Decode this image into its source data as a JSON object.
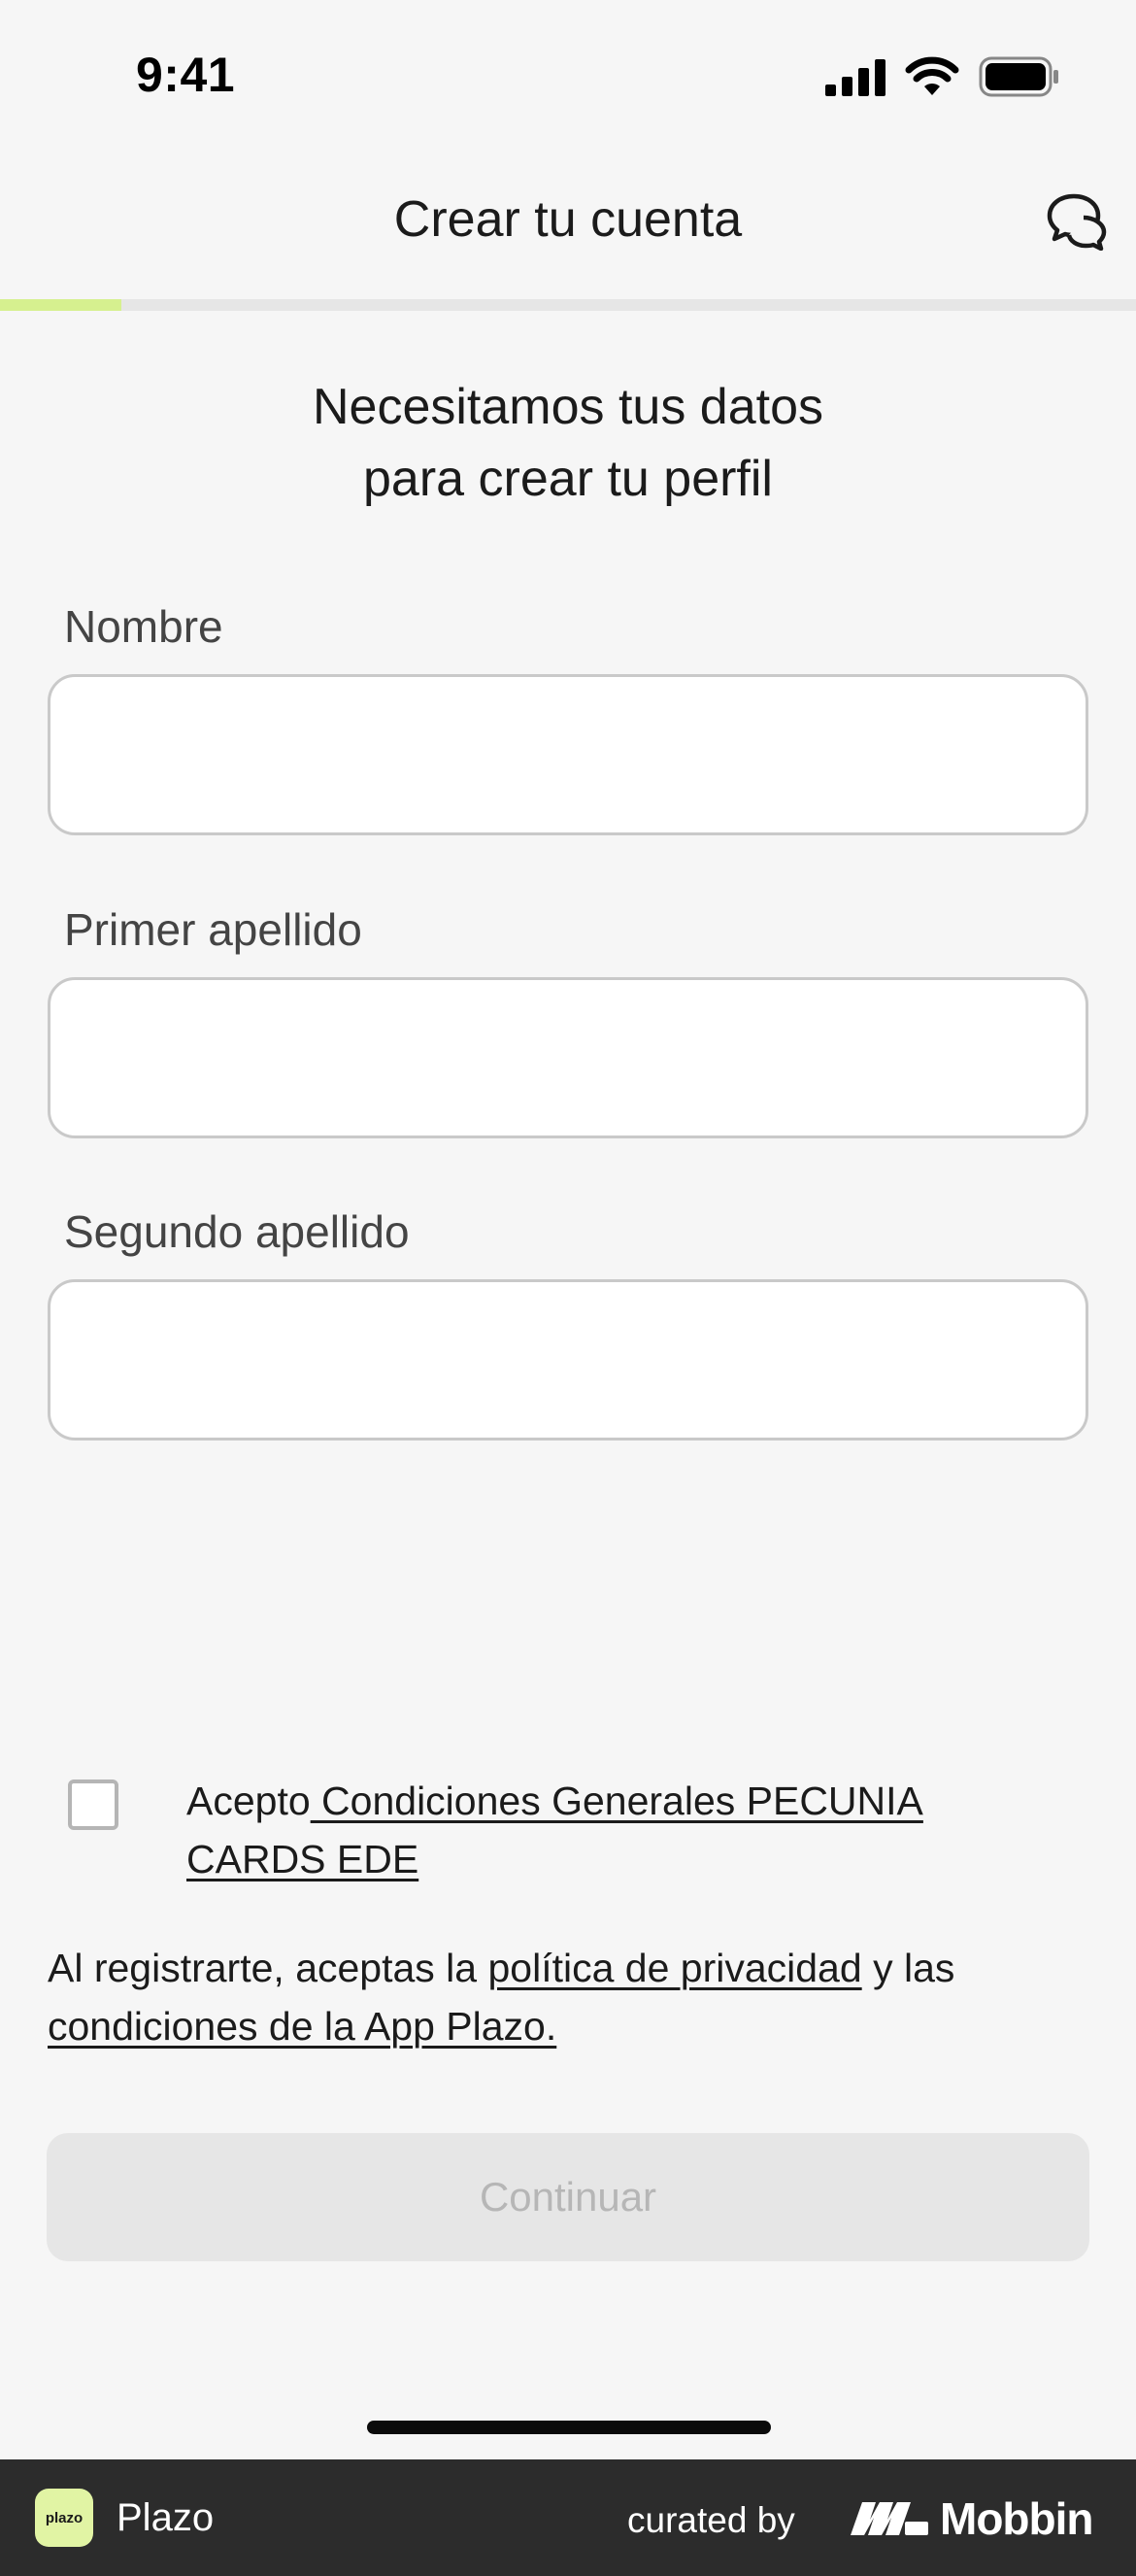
{
  "status_bar": {
    "time": "9:41"
  },
  "header": {
    "title": "Crear tu cuenta",
    "progress": 0.107
  },
  "subtitle": {
    "line1": "Necesitamos tus datos",
    "line2": "para crear tu perfil"
  },
  "form": {
    "first_name": {
      "label": "Nombre",
      "value": ""
    },
    "first_surname": {
      "label": "Primer apellido",
      "value": ""
    },
    "second_surname": {
      "label": "Segundo apellido",
      "value": ""
    }
  },
  "consent": {
    "prefix": "Acepto",
    "link": " Condiciones Generales PECUNIA CARDS EDE",
    "checked": false
  },
  "legal": {
    "part1": "Al registrarte, aceptas la ",
    "privacy_link": "política de privacidad",
    "part2": " y las ",
    "terms_link": "condiciones de la App Plazo."
  },
  "continue_button": {
    "label": "Continuar"
  },
  "footer": {
    "app_badge": "plazo",
    "app_name": "Plazo",
    "curated_by": "curated by",
    "brand": "Mobbin"
  },
  "colors": {
    "accent": "#d6f08f",
    "badge": "#e1f4a4",
    "footer_bg": "#2c2c2c"
  }
}
